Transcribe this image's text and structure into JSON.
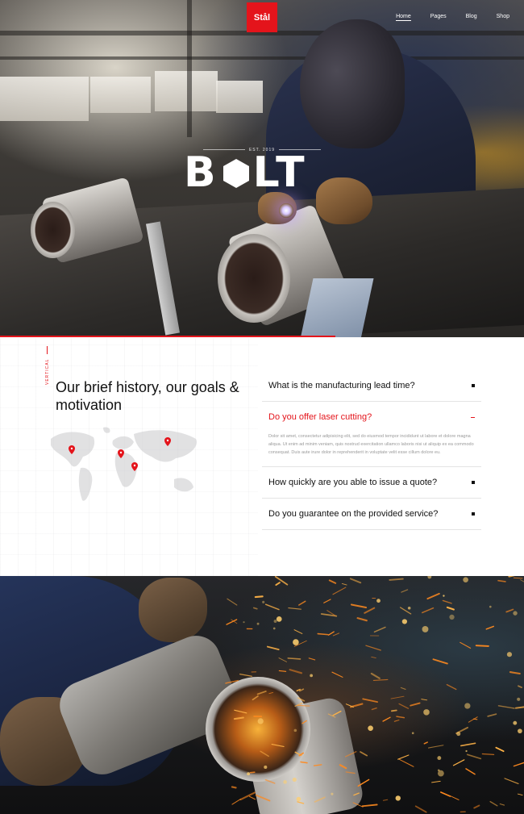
{
  "header": {
    "logo_text": "Stål",
    "nav": [
      {
        "label": "Home",
        "active": true
      },
      {
        "label": "Pages",
        "active": false
      },
      {
        "label": "Blog",
        "active": false
      },
      {
        "label": "Shop",
        "active": false
      }
    ]
  },
  "hero": {
    "established": "EST. 2019",
    "brand_left": "B",
    "brand_right": "LT",
    "slide_progress": 0.64
  },
  "about": {
    "vertical_tag": "VERTICAL",
    "title": "Our brief history, our goals & motivation"
  },
  "faq": [
    {
      "question": "What is the manufacturing lead time?",
      "open": false
    },
    {
      "question": "Do you offer laser cutting?",
      "open": true,
      "answer": "Dolor sit amet, consectetur adipisicing elit, sed do eiusmod tempor incididunt ut labore et dolore magna aliqua. Ut enim ad minim veniam, quis nostrud exercitation ullamco laboris nisi ut aliquip ex ea commodo consequat. Duis aute irure dolor in reprehenderit in voluptate velit esse cillum dolore eu."
    },
    {
      "question": "How quickly are you able to issue a quote?",
      "open": false
    },
    {
      "question": "Do you guarantee on the provided service?",
      "open": false
    }
  ],
  "colors": {
    "accent": "#e4141b",
    "text": "#111111",
    "muted": "#9a9a9a"
  },
  "icons": {
    "faq_closed": "square-bullet-icon",
    "faq_open": "minus-icon",
    "brand_mark": "hexagon-icon",
    "map_pin": "map-pin-icon"
  }
}
